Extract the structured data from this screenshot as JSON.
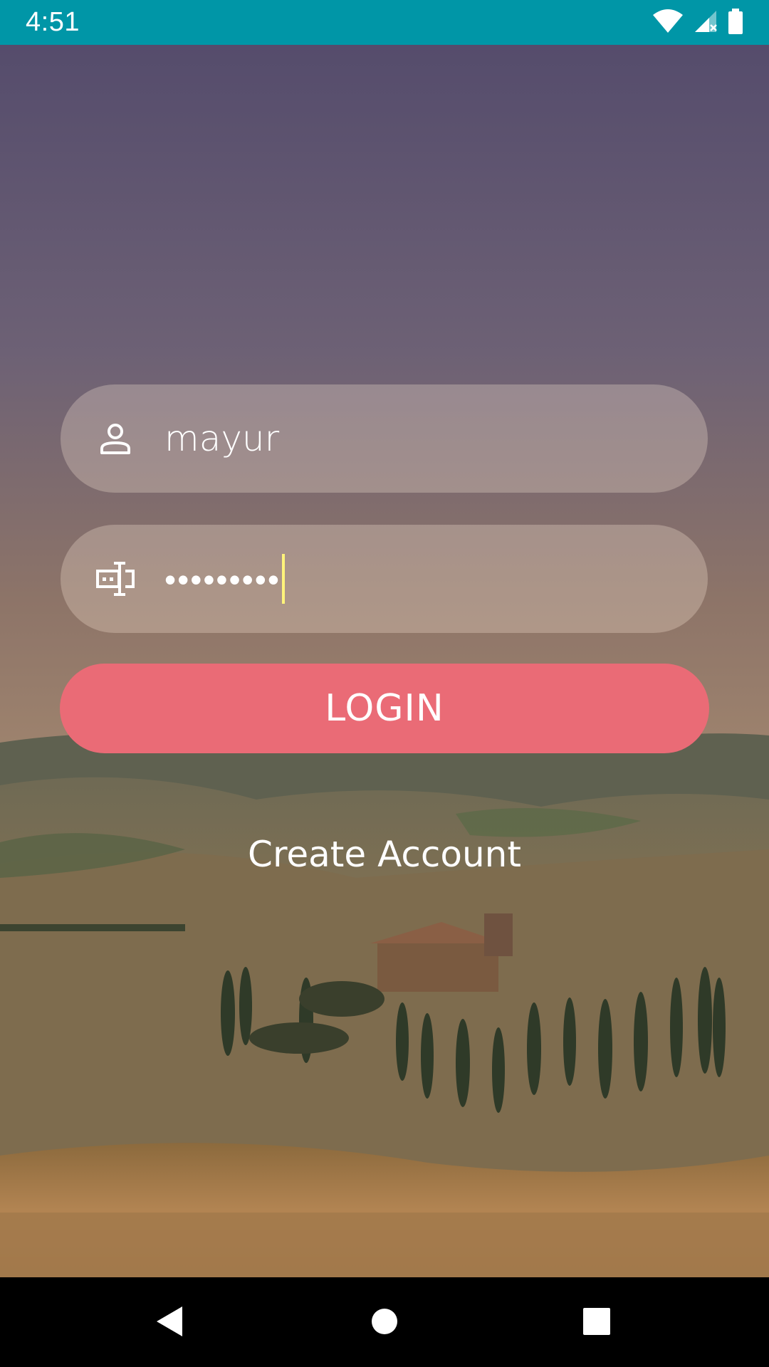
{
  "status_bar": {
    "time": "4:51",
    "icons": [
      "wifi-icon",
      "cell-signal-icon",
      "battery-icon"
    ],
    "color": "#0096a7"
  },
  "form": {
    "username": {
      "icon": "person-icon",
      "value": "mayur"
    },
    "password": {
      "icon": "password-icon",
      "value": "•••••••••"
    },
    "login_label": "LOGIN",
    "login_color": "#ea6b76",
    "create_account_label": "Create Account"
  },
  "nav_bar": {
    "buttons": [
      "back-icon",
      "home-icon",
      "recents-icon"
    ]
  }
}
